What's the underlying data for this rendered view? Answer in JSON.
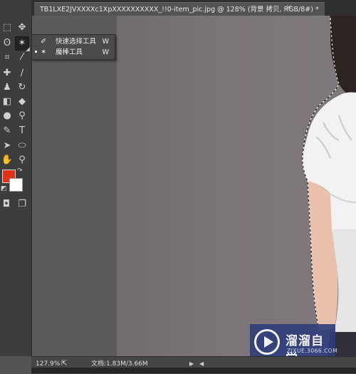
{
  "document_tab": {
    "title": "TB1LXE2JVXXXXc1XpXXXXXXXXXX_!!0-item_pic.jpg @ 128% (背景 拷贝, RGB/8#) *",
    "close_glyph": "×"
  },
  "tool_flyout": {
    "items": [
      {
        "label": "快速选择工具",
        "shortcut": "W",
        "icon": "quick-selection-icon",
        "selected": false
      },
      {
        "label": "魔棒工具",
        "shortcut": "W",
        "icon": "magic-wand-icon",
        "selected": true
      }
    ]
  },
  "toolbar": {
    "foreground_color": "#e0311b",
    "background_color": "#ffffff",
    "text_tool_glyph": "T"
  },
  "status_bar": {
    "zoom": "127.9%",
    "doc_info": "文档:1.83M/3.66M",
    "arrow_right": "▶",
    "arrow_left": "◀"
  },
  "watermark": {
    "title": "溜溜自学",
    "url": "ZIXUE.3066.COM"
  }
}
